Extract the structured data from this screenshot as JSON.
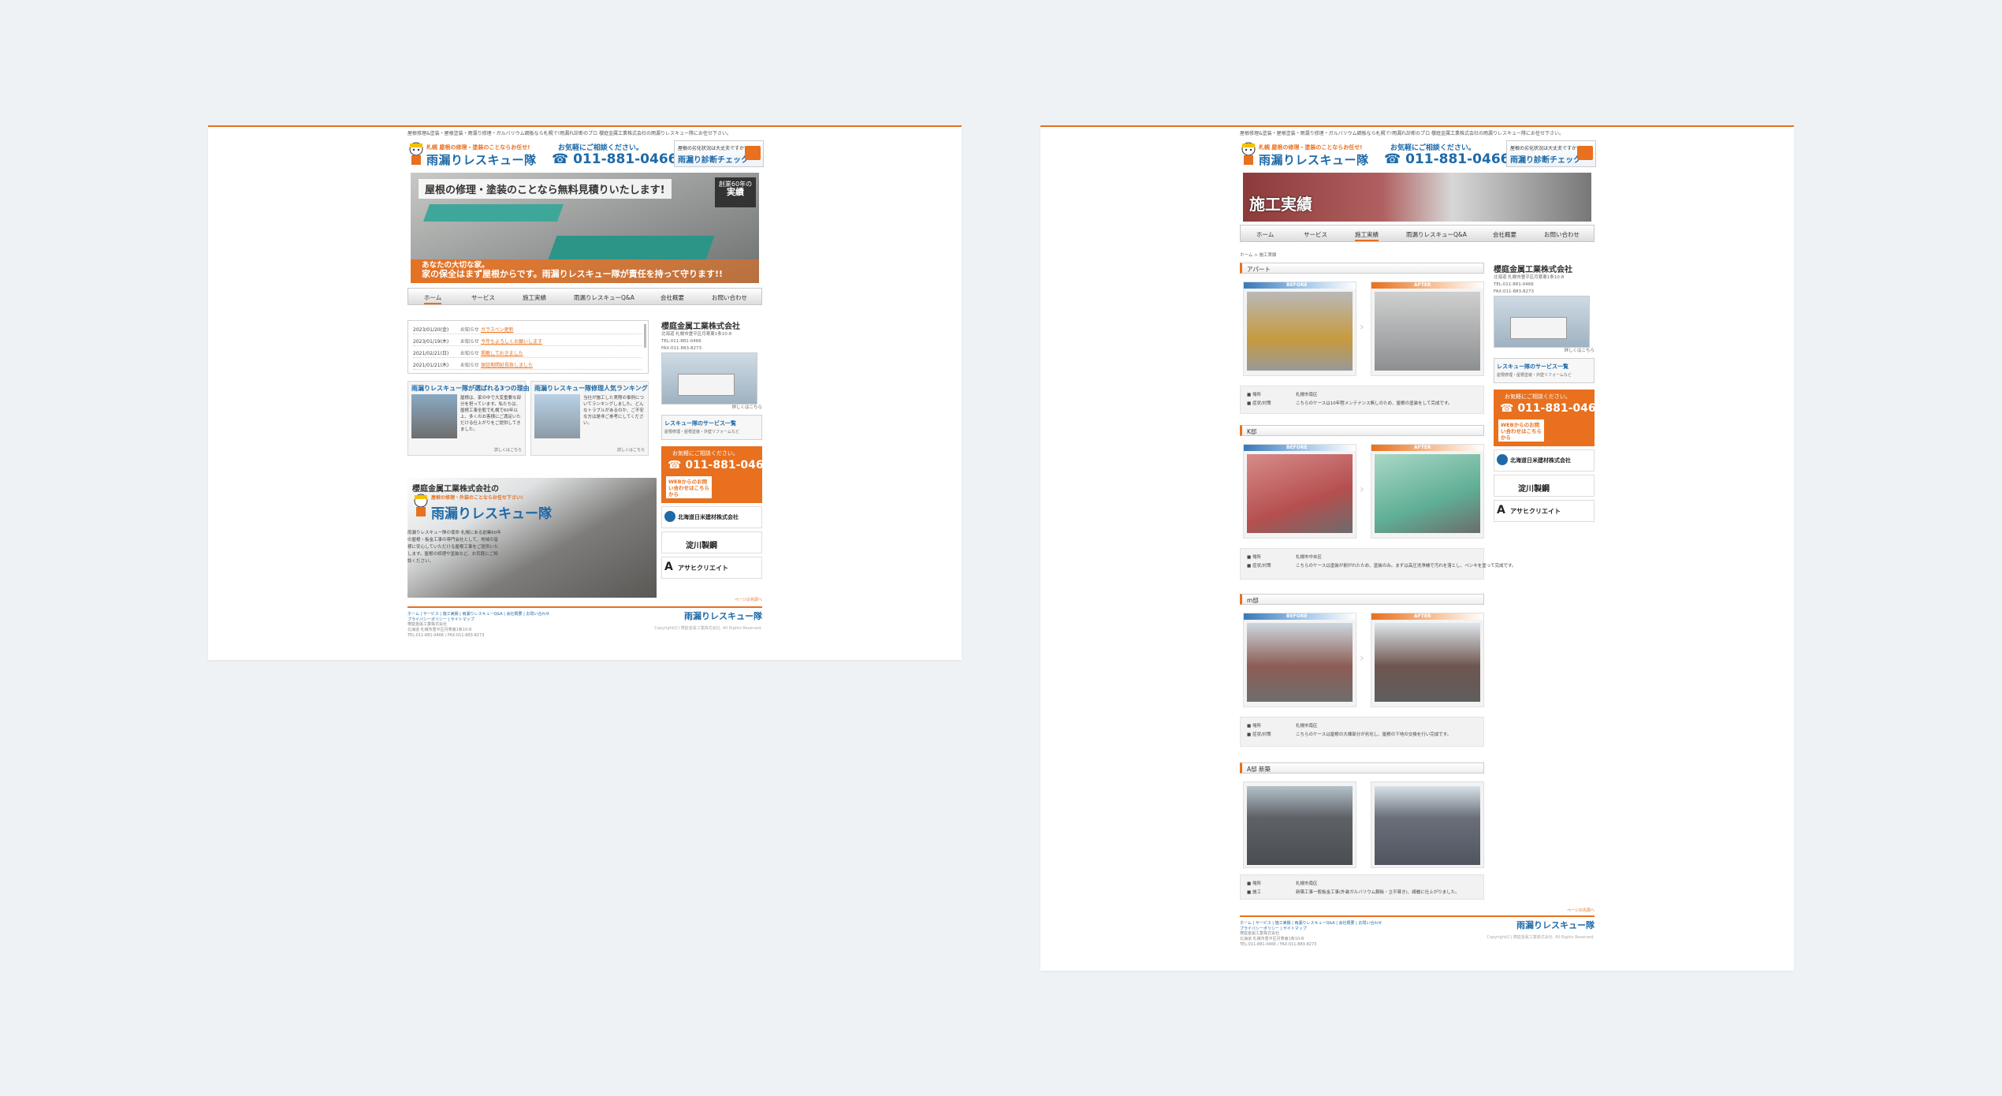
{
  "site": {
    "tagline": "屋根修理&塗装・屋根塗装・雨漏り修理・ガルバリウム鋼板なら札幌で!雨漏れ診断のプロ 櫻庭金属工業株式会社の雨漏りレスキュー隊にお任せ下さい。",
    "logo_top": "札幌 屋根の修理・塗装のことならお任せ!",
    "logo_main": "雨漏りレスキュー隊",
    "phone_lead": "お気軽にご相談ください。",
    "phone_number": "011-881-0466",
    "check_top": "屋根の劣化状況は大丈夫ですか?",
    "check_main": "雨漏り診断チェック",
    "nav": [
      "ホーム",
      "サービス",
      "施工実績",
      "雨漏りレスキューQ&A",
      "会社概要",
      "お問い合わせ"
    ]
  },
  "pageA": {
    "hero_title": "屋根の修理・塗装のことなら無料見積りいたします!",
    "hero_badge_line1": "創業60年の",
    "hero_badge_line2": "実績",
    "hero_msg1": "あなたの大切な家。",
    "hero_msg2": "家の保全はまず屋根からです。雨漏りレスキュー隊が責任を持って守ります!!",
    "news": [
      {
        "date": "2023/01/20(金)",
        "tag": "お知らせ",
        "title": "ガラスペン更新"
      },
      {
        "date": "2023/01/19(木)",
        "tag": "お知らせ",
        "title": "今年もよろしくお願いします"
      },
      {
        "date": "2021/02/21(日)",
        "tag": "お知らせ",
        "title": "掲載しておきました"
      },
      {
        "date": "2021/01/21(木)",
        "tag": "お知らせ",
        "title": "保証期間延長致しました"
      }
    ],
    "col1_title": "雨漏りレスキュー隊が選ばれる3つの理由",
    "col1_text": "屋根は、家の中で大変重要な部分を担っています。私たちは、屋根工事全般で札幌で60年以上、多くのお客様にご満足いただける仕上がりをご提供してきました。",
    "col2_title": "雨漏りレスキュー隊修理人気ランキング",
    "col2_text": "当社が施工した実際の事例についてランキングしました。どんなトラブルがあるのか、ご不安な方は是非ご参考にしてください。",
    "more": "詳しくはこちら",
    "company_line1": "櫻庭金属工業株式会社の",
    "company_logo_sub": "屋根の修理・外装のことならお任せ下さい!",
    "company_logo_main": "雨漏りレスキュー隊",
    "company_text": "雨漏りレスキュー隊の使命 札幌にある創業60年の屋根・板金工事の専門会社として、地域の皆様に安心していただける屋根工事をご提供いたします。屋根の修理や塗装など、お気軽にご相談ください。"
  },
  "side": {
    "company": "櫻庭金属工業株式会社",
    "address": "北海道 札幌市豊平区月寒東1条10-8",
    "tel": "TEL:011-881-0466",
    "fax": "FAX:011-883-8273",
    "more": "詳しくはこちら",
    "svc_title": "レスキュー隊のサービス一覧",
    "svc_sub": "屋根修理・屋根塗装・外壁リフォームなど",
    "banner_lead": "お気軽にご相談ください。",
    "banner_num": "011-881-0466",
    "banner_web": "WEBからのお問い合わせはこちらから",
    "sponsors": [
      "北海道日米建材株式会社",
      "淀川製鋼",
      "アサヒクリエイト"
    ]
  },
  "pageB": {
    "hero_title": "施工実績",
    "breadcrumb": "ホーム > 施工実績",
    "before": "BEFORE",
    "after": "AFTER",
    "sections": [
      {
        "title": "アパート",
        "loc_label": "■ 場所",
        "loc": "札幌市南区",
        "note_label": "■ 症状/対策",
        "note": "こちらのケースは10年程メンテナンス無しのため、屋根の塗装をして完成です。"
      },
      {
        "title": "K邸",
        "loc_label": "■ 場所",
        "loc": "札幌市中央区",
        "note_label": "■ 症状/対策",
        "note": "こちらのケースは塗装が剥がれたため、塗装のみ。まずは高圧洗浄機で汚れを落とし、ペンキを塗って完成です。"
      },
      {
        "title": "m邸",
        "loc_label": "■ 場所",
        "loc": "札幌市南区",
        "note_label": "■ 症状/対策",
        "note": "こちらのケースは屋根の大棟部分が劣化し、屋根の下地の交換を行い完成です。"
      },
      {
        "title": "A邸 新築",
        "loc_label": "■ 場所",
        "loc": "札幌市南区",
        "note_label": "■ 施工",
        "note": "新築工事一般板金工事(外装ガルバリウム鋼板・立平葺き)、綺麗に仕上がりました。"
      }
    ]
  },
  "footer": {
    "links": "ホーム | サービス | 施工実績 | 雨漏りレスキューQ&A | 会社概要 | お問い合わせ",
    "links2": "プライバシーポリシー | サイトマップ",
    "addr1": "櫻庭金属工業株式会社",
    "addr2": "北海道 札幌市豊平区月寒東1条10-8",
    "addr3": "TEL:011-881-0466 / FAX:011-883-8273",
    "copy": "Copyright(C) 櫻庭金属工業株式会社. All Rights Reserved.",
    "pagetop": "ページの先頭へ"
  },
  "colors": {
    "accent": "#e8701e",
    "brand": "#1e6aa8"
  }
}
